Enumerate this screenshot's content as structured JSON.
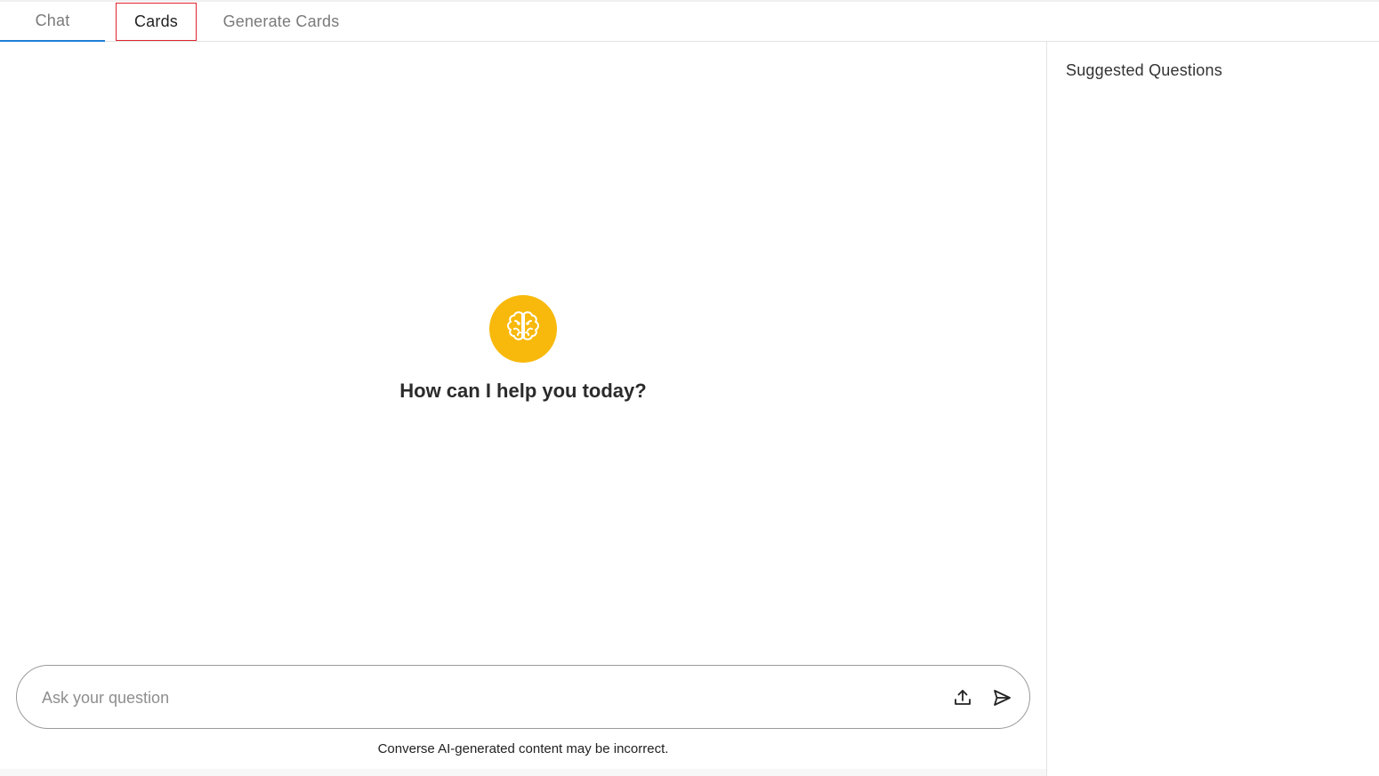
{
  "tabs": [
    {
      "label": "Chat",
      "active": true
    },
    {
      "label": "Cards",
      "highlighted": true
    },
    {
      "label": "Generate Cards"
    }
  ],
  "welcome": {
    "icon": "brain-icon",
    "badge_color": "#f8b90c",
    "message": "How can I help you today?"
  },
  "input": {
    "placeholder": "Ask your question",
    "value": ""
  },
  "actions": {
    "upload_icon": "upload-icon",
    "send_icon": "send-icon"
  },
  "disclaimer": "Converse AI-generated content may be incorrect.",
  "sidebar": {
    "title": "Suggested Questions",
    "questions": []
  },
  "colors": {
    "active_tab_underline": "#1f7fd6",
    "highlight_border": "#e0252f"
  }
}
